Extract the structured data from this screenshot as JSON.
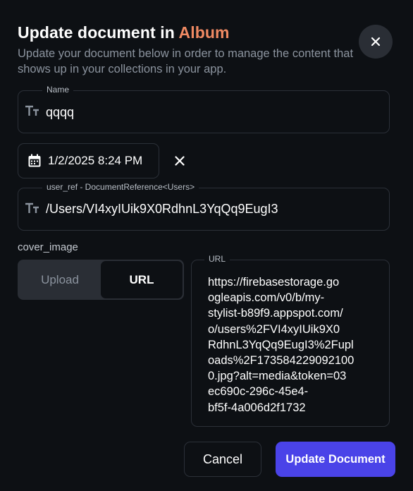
{
  "dialog": {
    "title_prefix": "Update document in ",
    "title_collection": "Album",
    "subtitle": "Update your document below in order to manage the content that shows up in your collections in your app.",
    "close_icon": "close-icon"
  },
  "fields": {
    "name": {
      "label": "Name",
      "value": "qqqq",
      "icon": "text-type-icon"
    },
    "date": {
      "value": "1/2/2025 8:24 PM",
      "icon": "calendar-icon",
      "clear_icon": "close-icon"
    },
    "user_ref": {
      "label": "user_ref - DocumentReference<Users>",
      "value": "/Users/VI4xyIUik9X0RdhnL3YqQq9EugI3",
      "icon": "text-type-icon"
    }
  },
  "cover_image": {
    "label": "cover_image",
    "options": [
      "Upload",
      "URL"
    ],
    "selected": "URL",
    "url_label": "URL",
    "url_value": "https://firebasestorage.go\nogleapis.com/v0/b/my-\nstylist-b89f9.appspot.com/\no/users%2FVI4xyIUik9X0\nRdhnL3YqQq9EugI3%2Fupl\noads%2F173584229092100\n0.jpg?alt=media&token=03\nec690c-296c-45e4-\nbf5f-4a006d2f1732"
  },
  "actions": {
    "cancel_label": "Cancel",
    "update_label": "Update Document"
  },
  "colors": {
    "background": "#0d1014",
    "accent_orange": "#f08a63",
    "primary_button": "#4a43e8",
    "border": "#2b3038"
  }
}
